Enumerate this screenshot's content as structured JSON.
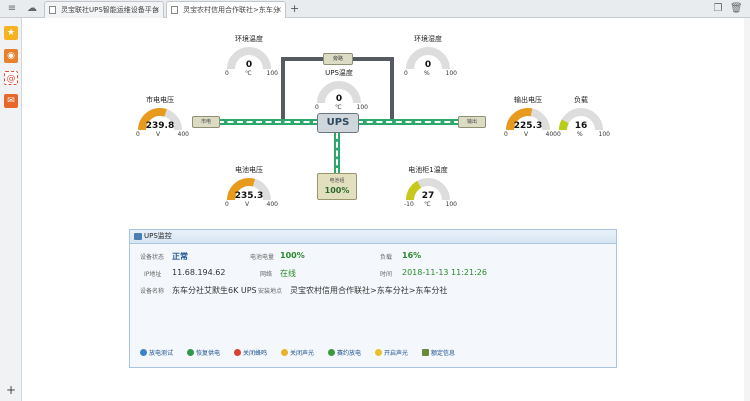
{
  "browser": {
    "tabs": [
      {
        "label": "灵宝联社UPS智能运维设备平台"
      },
      {
        "label": "灵宝农村信用合作联社>东车分"
      }
    ],
    "new_tab": "+"
  },
  "sidebar": {
    "items": [
      {
        "icon": "star-icon",
        "color": "#f5b324"
      },
      {
        "icon": "weibo-icon",
        "color": "#e8802c"
      },
      {
        "icon": "mail-at-icon",
        "color": "#e24c3f"
      },
      {
        "icon": "gift-icon",
        "color": "#e8682c"
      }
    ],
    "add": "+"
  },
  "diagram": {
    "nodes": {
      "input": "市电",
      "bypass": "旁路",
      "output": "输出",
      "ups": "UPS",
      "battery_label": "电池组",
      "battery_value": "100%"
    },
    "gauges": [
      {
        "id": "env-temp",
        "title": "环境温度",
        "value": "0",
        "min": "0",
        "unit": "℃",
        "max": "100",
        "fraction": 0,
        "color": "#e89a1c"
      },
      {
        "id": "env-humidity",
        "title": "环境湿度",
        "value": "0",
        "min": "0",
        "unit": "%",
        "max": "100",
        "fraction": 0,
        "color": "#e89a1c"
      },
      {
        "id": "ups-temp",
        "title": "UPS温度",
        "value": "0",
        "min": "0",
        "unit": "℃",
        "max": "100",
        "fraction": 0,
        "color": "#e89a1c"
      },
      {
        "id": "mains-voltage",
        "title": "市电电压",
        "value": "239.8",
        "min": "0",
        "unit": "V",
        "max": "400",
        "fraction": 0.6,
        "color": "#e89a1c"
      },
      {
        "id": "output-voltage",
        "title": "输出电压",
        "value": "225.3",
        "min": "0",
        "unit": "V",
        "max": "400",
        "fraction": 0.563,
        "color": "#e89a1c"
      },
      {
        "id": "load",
        "title": "负载",
        "value": "16",
        "min": "0",
        "unit": "%",
        "max": "100",
        "fraction": 0.16,
        "color": "#b8cc1a"
      },
      {
        "id": "battery-voltage",
        "title": "电池电压",
        "value": "235.3",
        "min": "0",
        "unit": "V",
        "max": "400",
        "fraction": 0.588,
        "color": "#e89a1c"
      },
      {
        "id": "battery-cabinet-temp",
        "title": "电池柜1温度",
        "value": "27",
        "min": "-10",
        "unit": "℃",
        "max": "100",
        "fraction": 0.336,
        "color": "#c6c81a"
      }
    ]
  },
  "panel": {
    "title": "UPS监控",
    "fields": {
      "status_label": "设备状态",
      "status_value": "正常",
      "battery_label": "电池电量",
      "battery_value": "100%",
      "load_label": "负载",
      "load_value": "16%",
      "ip_label": "IP地址",
      "ip_value": "11.68.194.62",
      "network_label": "网络",
      "network_value": "在线",
      "time_label": "时间",
      "time_value": "2018-11-13 11:21:26",
      "device_label": "设备名称",
      "device_value": "东车分社艾默生6K UPS",
      "location_label": "安装地点",
      "location_value": "灵宝农村信用合作联社>东车分社>东车分社"
    },
    "actions": [
      {
        "label": "放电测试",
        "color": "#3d82c4"
      },
      {
        "label": "恢复供电",
        "color": "#2e9a4a"
      },
      {
        "label": "关闭蜂鸣",
        "color": "#d9402f"
      },
      {
        "label": "关闭声光",
        "color": "#e8b42a"
      },
      {
        "label": "赛约放电",
        "color": "#3a9a3a"
      },
      {
        "label": "开启声光",
        "color": "#e8c22a"
      },
      {
        "label": "额定信息",
        "color": "#6a8a3a"
      }
    ]
  }
}
